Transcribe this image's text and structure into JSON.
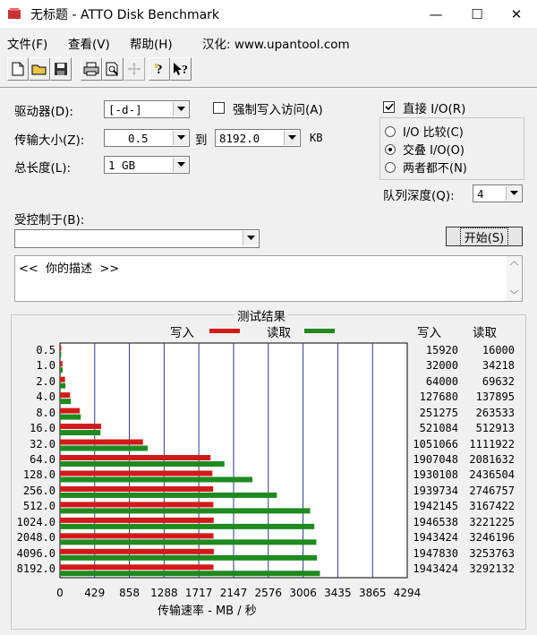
{
  "window": {
    "title": "无标题 - ATTO Disk Benchmark",
    "minimize": "—",
    "maximize": "☐",
    "close": "✕"
  },
  "menu": [
    {
      "label": "文件(F)"
    },
    {
      "label": "查看(V)"
    },
    {
      "label": "帮助(H)"
    },
    {
      "label": "汉化: www.upantool.com"
    }
  ],
  "toolbar": {
    "icons": [
      "new-file-icon",
      "open-folder-icon",
      "save-icon",
      "print-icon",
      "print-preview-icon",
      "move-icon",
      "help-icon",
      "context-help-icon"
    ]
  },
  "settings": {
    "drive_label": "驱动器(D):",
    "drive_value": "[-d-]",
    "transfer_label": "传输大小(Z):",
    "transfer_from": "0.5",
    "transfer_to_label": "到",
    "transfer_to": "8192.0",
    "transfer_unit": "KB",
    "total_label": "总长度(L):",
    "total_value": "1 GB",
    "force_write_label": "强制写入访问(A)",
    "force_write_checked": false,
    "direct_io_label": "直接 I/O(R)",
    "direct_io_checked": true,
    "io_compare_label": "I/O 比较(C)",
    "overlap_io_label": "交叠 I/O(O)",
    "neither_label": "两者都不(N)",
    "selected_mode": "overlap",
    "queue_label": "队列深度(Q):",
    "queue_value": "4",
    "controlled_label": "受控制于(B):",
    "controlled_value": "",
    "start_button": "开始(S)",
    "description": "<<  你的描述  >>"
  },
  "results": {
    "group_title": "测试结果",
    "legend_write": "写入",
    "legend_read": "读取",
    "write_col_header": "写入",
    "read_col_header": "读取",
    "xaxis_label": "传输速率 - MB / 秒"
  },
  "chart_data": {
    "type": "bar",
    "orientation": "horizontal",
    "categories": [
      "0.5",
      "1.0",
      "2.0",
      "4.0",
      "8.0",
      "16.0",
      "32.0",
      "64.0",
      "128.0",
      "256.0",
      "512.0",
      "1024.0",
      "2048.0",
      "4096.0",
      "8192.0"
    ],
    "series": [
      {
        "name": "写入",
        "color": "#d11a1a",
        "values": [
          15920,
          32000,
          64000,
          127680,
          251275,
          521084,
          1051066,
          1907048,
          1930108,
          1939734,
          1942145,
          1946538,
          1943424,
          1947830,
          1943424
        ]
      },
      {
        "name": "读取",
        "color": "#1f8a1f",
        "values": [
          16000,
          34218,
          69632,
          137895,
          263533,
          512913,
          1111922,
          2081632,
          2436504,
          2746757,
          3167422,
          3221225,
          3246196,
          3253763,
          3292132
        ]
      }
    ],
    "value_display_scale": 1024,
    "xticks": [
      "0",
      "429",
      "858",
      "1288",
      "1717",
      "2147",
      "2576",
      "3006",
      "3435",
      "3865",
      "4294"
    ],
    "xlim": [
      0,
      4294
    ],
    "xlabel": "传输速率 - MB / 秒",
    "grid": true
  }
}
